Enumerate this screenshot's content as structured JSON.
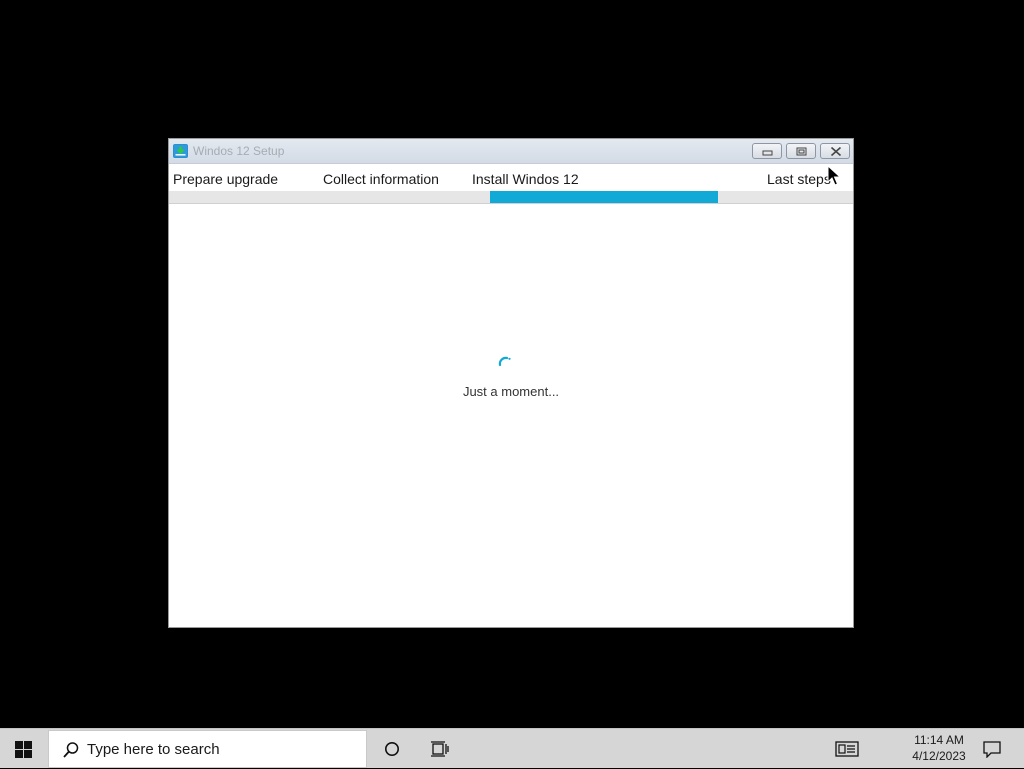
{
  "window": {
    "title": "Windos 12 Setup",
    "steps": [
      {
        "label": "Prepare upgrade"
      },
      {
        "label": "Collect information"
      },
      {
        "label": "Install Windos 12"
      },
      {
        "label": "Last steps"
      }
    ],
    "active_step": 3,
    "accent_color": "#11a9d6",
    "status_text": "Just a moment..."
  },
  "taskbar": {
    "search_placeholder": "Type here to search",
    "time": "11:14 AM",
    "date": "4/12/2023",
    "icons": [
      "windows-start-icon",
      "search-icon",
      "cortana-icon",
      "task-view-icon",
      "news-icon",
      "notification-icon"
    ]
  }
}
